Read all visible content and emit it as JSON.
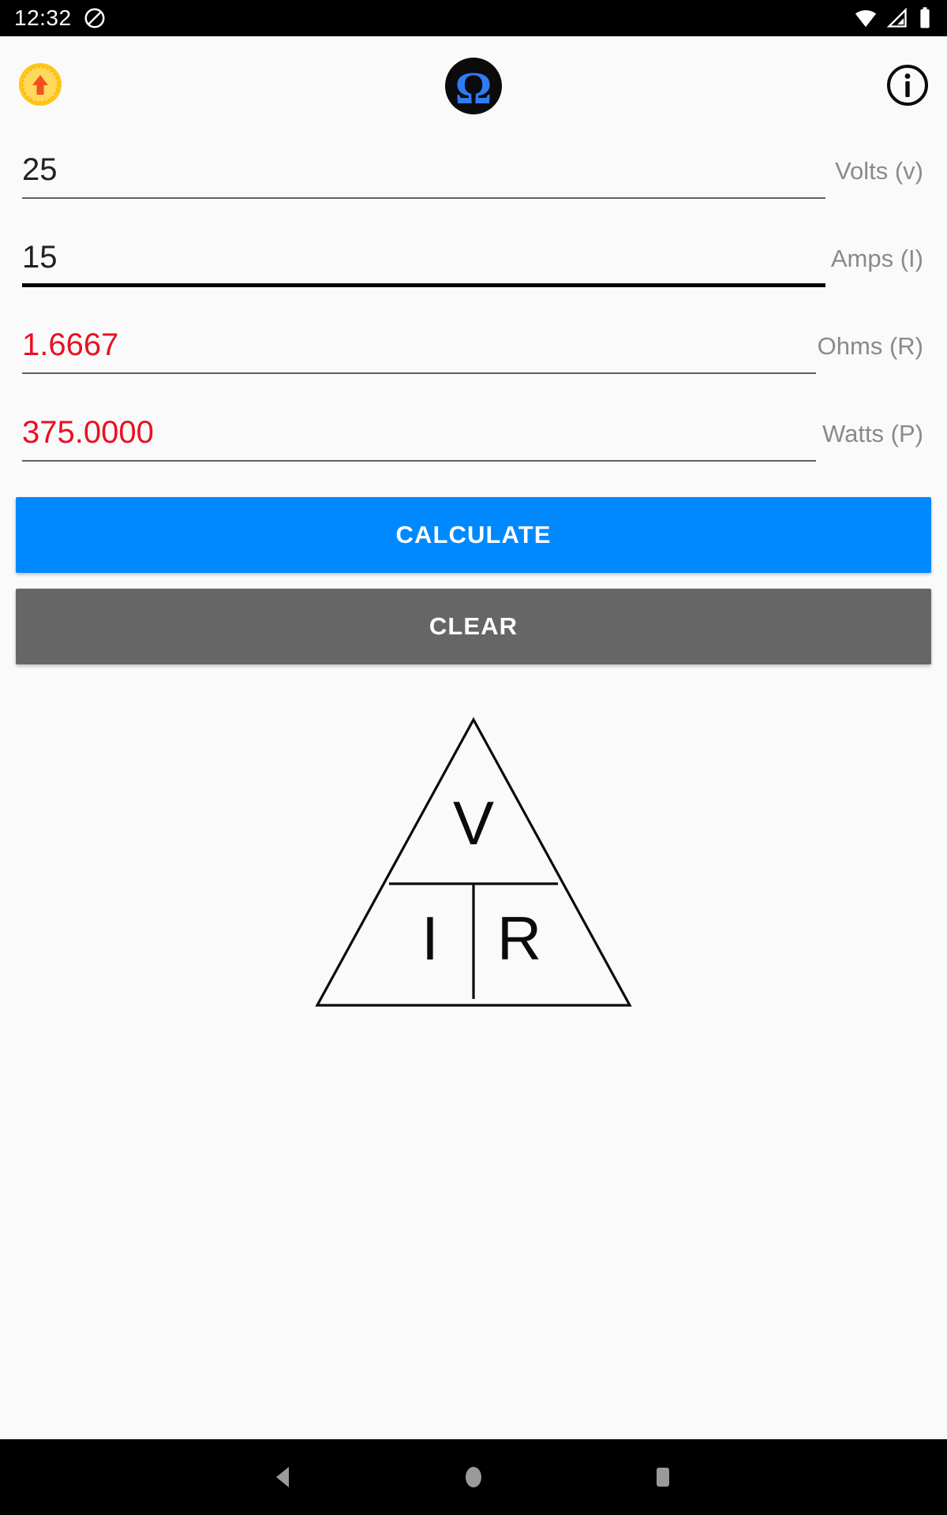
{
  "status_bar": {
    "clock": "12:32",
    "icons": [
      {
        "name": "do-not-disturb-icon",
        "glyph": "⊘"
      },
      {
        "name": "wifi-icon",
        "glyph": "wifi"
      },
      {
        "name": "cell-signal-icon",
        "glyph": "signal"
      },
      {
        "name": "battery-icon",
        "glyph": "battery"
      }
    ]
  },
  "header": {
    "coin_icon": "coin-upgrade-icon",
    "app_logo": "omega-logo-icon",
    "omega_symbol": "Ω",
    "info_icon": "info-icon"
  },
  "fields": [
    {
      "id": "volts",
      "name": "volts-input",
      "value": "25",
      "placeholder": "",
      "label": "Volts (v)",
      "readonly": false,
      "focused": false,
      "text_color": "#212121"
    },
    {
      "id": "amps",
      "name": "amps-input",
      "value": "15",
      "placeholder": "",
      "label": "Amps (I)",
      "readonly": false,
      "focused": true,
      "text_color": "#212121"
    },
    {
      "id": "ohms",
      "name": "ohms-result",
      "value": "1.6667",
      "placeholder": "",
      "label": "Ohms (R)",
      "readonly": true,
      "focused": false,
      "text_color": "#E81123"
    },
    {
      "id": "watts",
      "name": "watts-result",
      "value": "375.0000",
      "placeholder": "",
      "label": "Watts (P)",
      "readonly": true,
      "focused": false,
      "text_color": "#E81123"
    }
  ],
  "buttons": {
    "calculate_label": "CALCULATE",
    "clear_label": "CLEAR",
    "calculate_color": "#0089FF",
    "clear_color": "#666666"
  },
  "diagram": {
    "name": "ohms-law-triangle",
    "top_letter": "V",
    "bottom_left_letter": "I",
    "bottom_right_letter": "R"
  },
  "nav_bar": {
    "back_label": "back-button",
    "home_label": "home-button",
    "recents_label": "recents-button"
  },
  "colors": {
    "accent": "#0089FF",
    "secondary": "#666666",
    "result_text": "#E81123",
    "label_text": "#8A8A8A",
    "surface": "#FAFAFA",
    "system_bar": "#000000"
  }
}
